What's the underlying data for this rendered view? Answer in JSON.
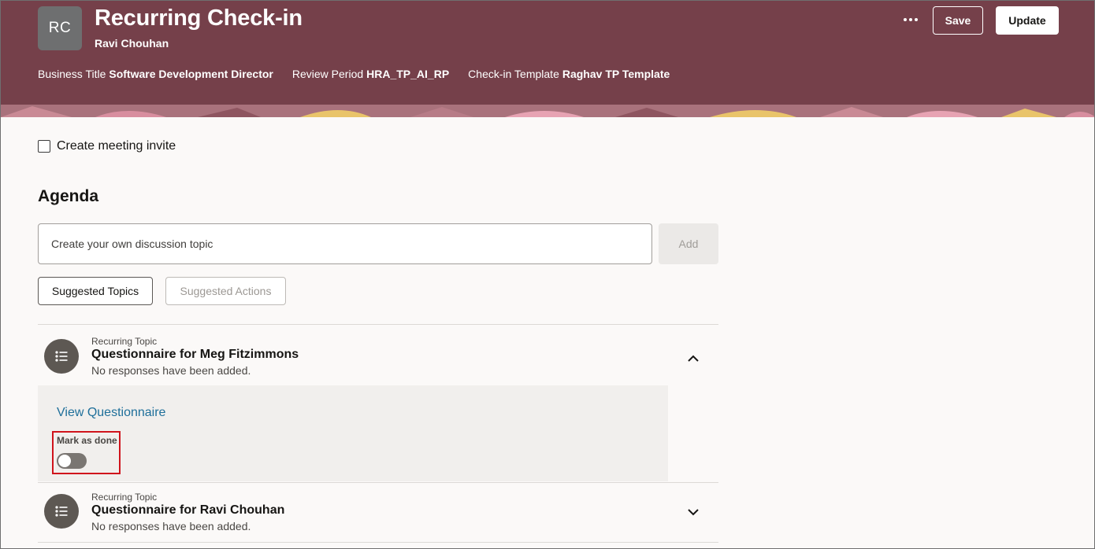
{
  "header": {
    "avatar_initials": "RC",
    "title": "Recurring Check-in",
    "person_name": "Ravi Chouhan",
    "meta": [
      {
        "key": "Business Title",
        "value": "Software Development Director"
      },
      {
        "key": "Review Period",
        "value": "HRA_TP_AI_RP"
      },
      {
        "key": "Check-in Template",
        "value": "Raghav TP Template"
      }
    ],
    "more_icon": "more-horizontal-icon",
    "save_label": "Save",
    "update_label": "Update",
    "colors": {
      "banner": "#75404a",
      "accent_yellow": "#e9c46a",
      "accent_pink": "#e7a3b3"
    }
  },
  "invite": {
    "label": "Create meeting invite",
    "checked": false
  },
  "agenda": {
    "title": "Agenda",
    "input_placeholder": "Create your own discussion topic",
    "add_label": "Add",
    "tabs": [
      {
        "label": "Suggested Topics",
        "enabled": true
      },
      {
        "label": "Suggested Actions",
        "enabled": false
      }
    ],
    "topics": [
      {
        "kicker": "Recurring Topic",
        "title": "Questionnaire for Meg Fitzimmons",
        "status": "No responses have been added.",
        "icon": "list-icon",
        "expanded": true,
        "link_label": "View Questionnaire",
        "mark_done_label": "Mark as done",
        "mark_done_on": false
      },
      {
        "kicker": "Recurring Topic",
        "title": "Questionnaire for Ravi Chouhan",
        "status": "No responses have been added.",
        "icon": "list-icon",
        "expanded": false
      }
    ],
    "colors": {
      "link": "#1e6f9a",
      "highlight_border": "#d0141c"
    }
  }
}
